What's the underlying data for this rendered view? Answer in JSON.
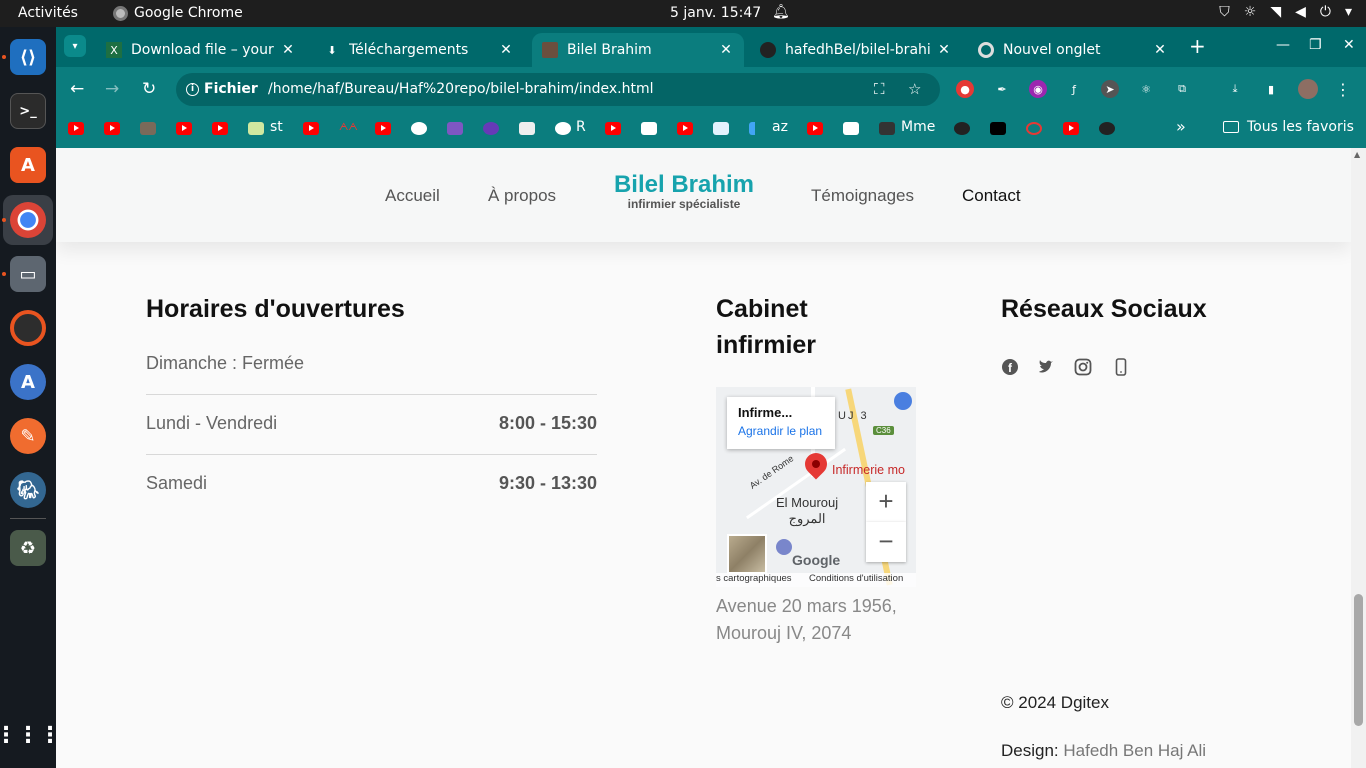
{
  "os": {
    "activities": "Activités",
    "app_name": "Google Chrome",
    "clock": "5 janv.  15:47"
  },
  "browser": {
    "tabs": [
      {
        "title": "Download file – your c",
        "favicon": "excel-icon"
      },
      {
        "title": "Téléchargements",
        "favicon": "download-icon"
      },
      {
        "title": "Bilel Brahim",
        "favicon": "site-icon",
        "active": true
      },
      {
        "title": "hafedhBel/bilel-brahi",
        "favicon": "github-icon"
      },
      {
        "title": "Nouvel onglet",
        "favicon": "chrome-icon"
      }
    ],
    "address": {
      "security_label": "Fichier",
      "url": "/home/haf/Bureau/Haf%20repo/bilel-brahim/index.html"
    },
    "bookmarks": {
      "labels": [
        "st",
        "R",
        "az",
        "Mme"
      ],
      "all_favorites": "Tous les favoris",
      "overflow": "»"
    },
    "colors": {
      "frame": "#00696b",
      "toolbar": "#0b7d7e"
    }
  },
  "site": {
    "nav": {
      "home": "Accueil",
      "about": "À propos",
      "brand_name": "Bilel Brahim",
      "brand_sub": "infirmier spécialiste",
      "testimonials": "Témoignages",
      "contact": "Contact"
    },
    "hours": {
      "heading": "Horaires d'ouvertures",
      "rows": [
        {
          "day": "Dimanche : Fermée",
          "time": ""
        },
        {
          "day": "Lundi - Vendredi",
          "time": "8:00 - 15:30"
        },
        {
          "day": "Samedi",
          "time": "9:30 - 13:30"
        }
      ]
    },
    "cabinet": {
      "heading": "Cabinet infirmier",
      "map": {
        "info_title": "Infirme...",
        "info_link": "Agrandir le plan",
        "pin_label": "Infirmerie mo",
        "place_fr": "El Mourouj",
        "place_ar": "المروج",
        "street": "Av. de Rome",
        "road_badge": "C36",
        "district": "UJ 3",
        "logo": "Google",
        "attribution_left": "s cartographiques",
        "attribution_right": "Conditions d'utilisation",
        "zoom_in": "+",
        "zoom_out": "−"
      },
      "address": "Avenue 20 mars 1956, Mourouj IV, 2074"
    },
    "social": {
      "heading": "Réseaux Sociaux",
      "icons": [
        "facebook-icon",
        "twitter-icon",
        "instagram-icon",
        "phone-icon"
      ]
    },
    "footer": {
      "copyright": "© 2024 Dgitex",
      "design_label": "Design:",
      "designer": "Hafedh Ben Haj Ali"
    },
    "colors": {
      "brand": "#17a3ad"
    }
  }
}
